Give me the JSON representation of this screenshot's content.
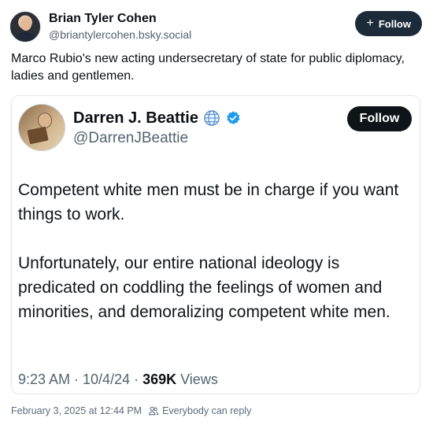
{
  "author": {
    "name": "Brian Tyler Cohen",
    "handle": "@briantylercohen.bsky.social",
    "follow_label": "Follow",
    "follow_icon": "plus-icon"
  },
  "post": {
    "text": "Marco Rubio's new acting undersecretary of state for public diplomacy, ladies and gentlemen."
  },
  "embed": {
    "name": "Darren J. Beattie",
    "handle": "@DarrenJBeattie",
    "follow_label": "Follow",
    "badges": [
      "globe-icon",
      "verified-icon"
    ],
    "paragraphs": [
      "Competent white men must be in charge if you want things to work.",
      "Unfortunately, our entire national ideology is predicated on coddling the feelings of women and minorities, and demoralizing competent white men."
    ],
    "time": "9:23 AM · 10/4/24 · ",
    "views_count": "369K",
    "views_label": " Views"
  },
  "footer": {
    "date": "February 3, 2025 at 12:44 PM",
    "reply_setting": "Everybody can reply"
  },
  "colors": {
    "follow_top_bg": "#1c2b3a",
    "follow_embed_bg": "#0f1419",
    "verified_blue": "#1d9bf0",
    "muted_text": "#536471"
  }
}
